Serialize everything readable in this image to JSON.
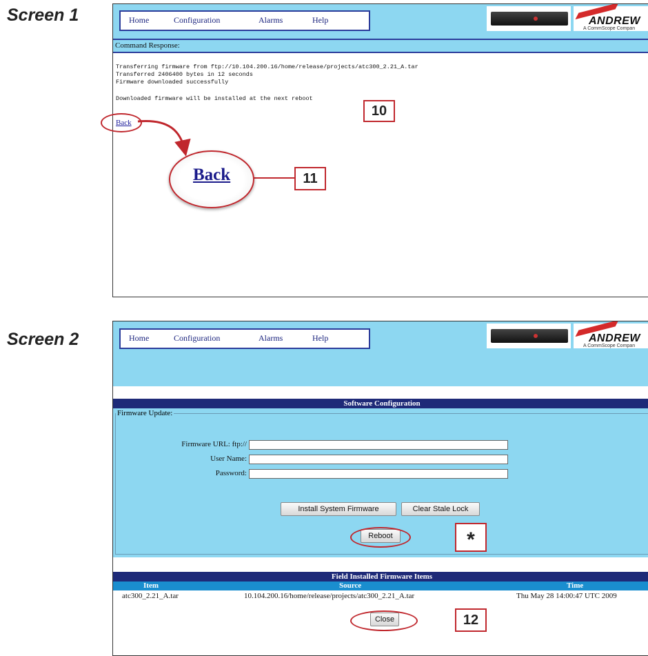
{
  "labels": {
    "screen1": "Screen 1",
    "screen2": "Screen 2"
  },
  "nav": {
    "home": "Home",
    "configuration": "Configuration",
    "alarms": "Alarms",
    "help": "Help"
  },
  "brand": {
    "name": "ANDREW",
    "tagline": "A CommScope Compan"
  },
  "screen1": {
    "bar_title": "Command Response:",
    "lines": [
      "Transferring firmware from ftp://10.104.200.16/home/release/projects/atc300_2.21_A.tar",
      "Transferred 2406400 bytes in 12 seconds",
      "Firmware downloaded successfully",
      "Downloaded firmware will be installed at the next reboot"
    ],
    "back_link": "Back",
    "back_zoom": "Back",
    "callout_10": "10",
    "callout_11": "11"
  },
  "screen2": {
    "section_title": "Software Configuration",
    "group_title": "Firmware Update:",
    "fields": {
      "url_label": "Firmware URL: ftp://",
      "url_value": "",
      "user_label": "User Name:",
      "user_value": "",
      "password_label": "Password:",
      "password_value": ""
    },
    "buttons": {
      "install": "Install System Firmware",
      "clear": "Clear Stale Lock",
      "reboot": "Reboot",
      "close": "Close"
    },
    "table": {
      "title": "Field Installed Firmware Items",
      "headers": [
        "Item",
        "Source",
        "Time"
      ],
      "rows": [
        [
          "atc300_2.21_A.tar",
          "10.104.200.16/home/release/projects/atc300_2.21_A.tar",
          "Thu May 28 14:00:47 UTC 2009"
        ]
      ]
    },
    "callout_star": "*",
    "callout_12": "12"
  },
  "colors": {
    "header_blue": "#8dd7f1",
    "dark_blue": "#1e2a78",
    "callout_red": "#c0272d"
  }
}
